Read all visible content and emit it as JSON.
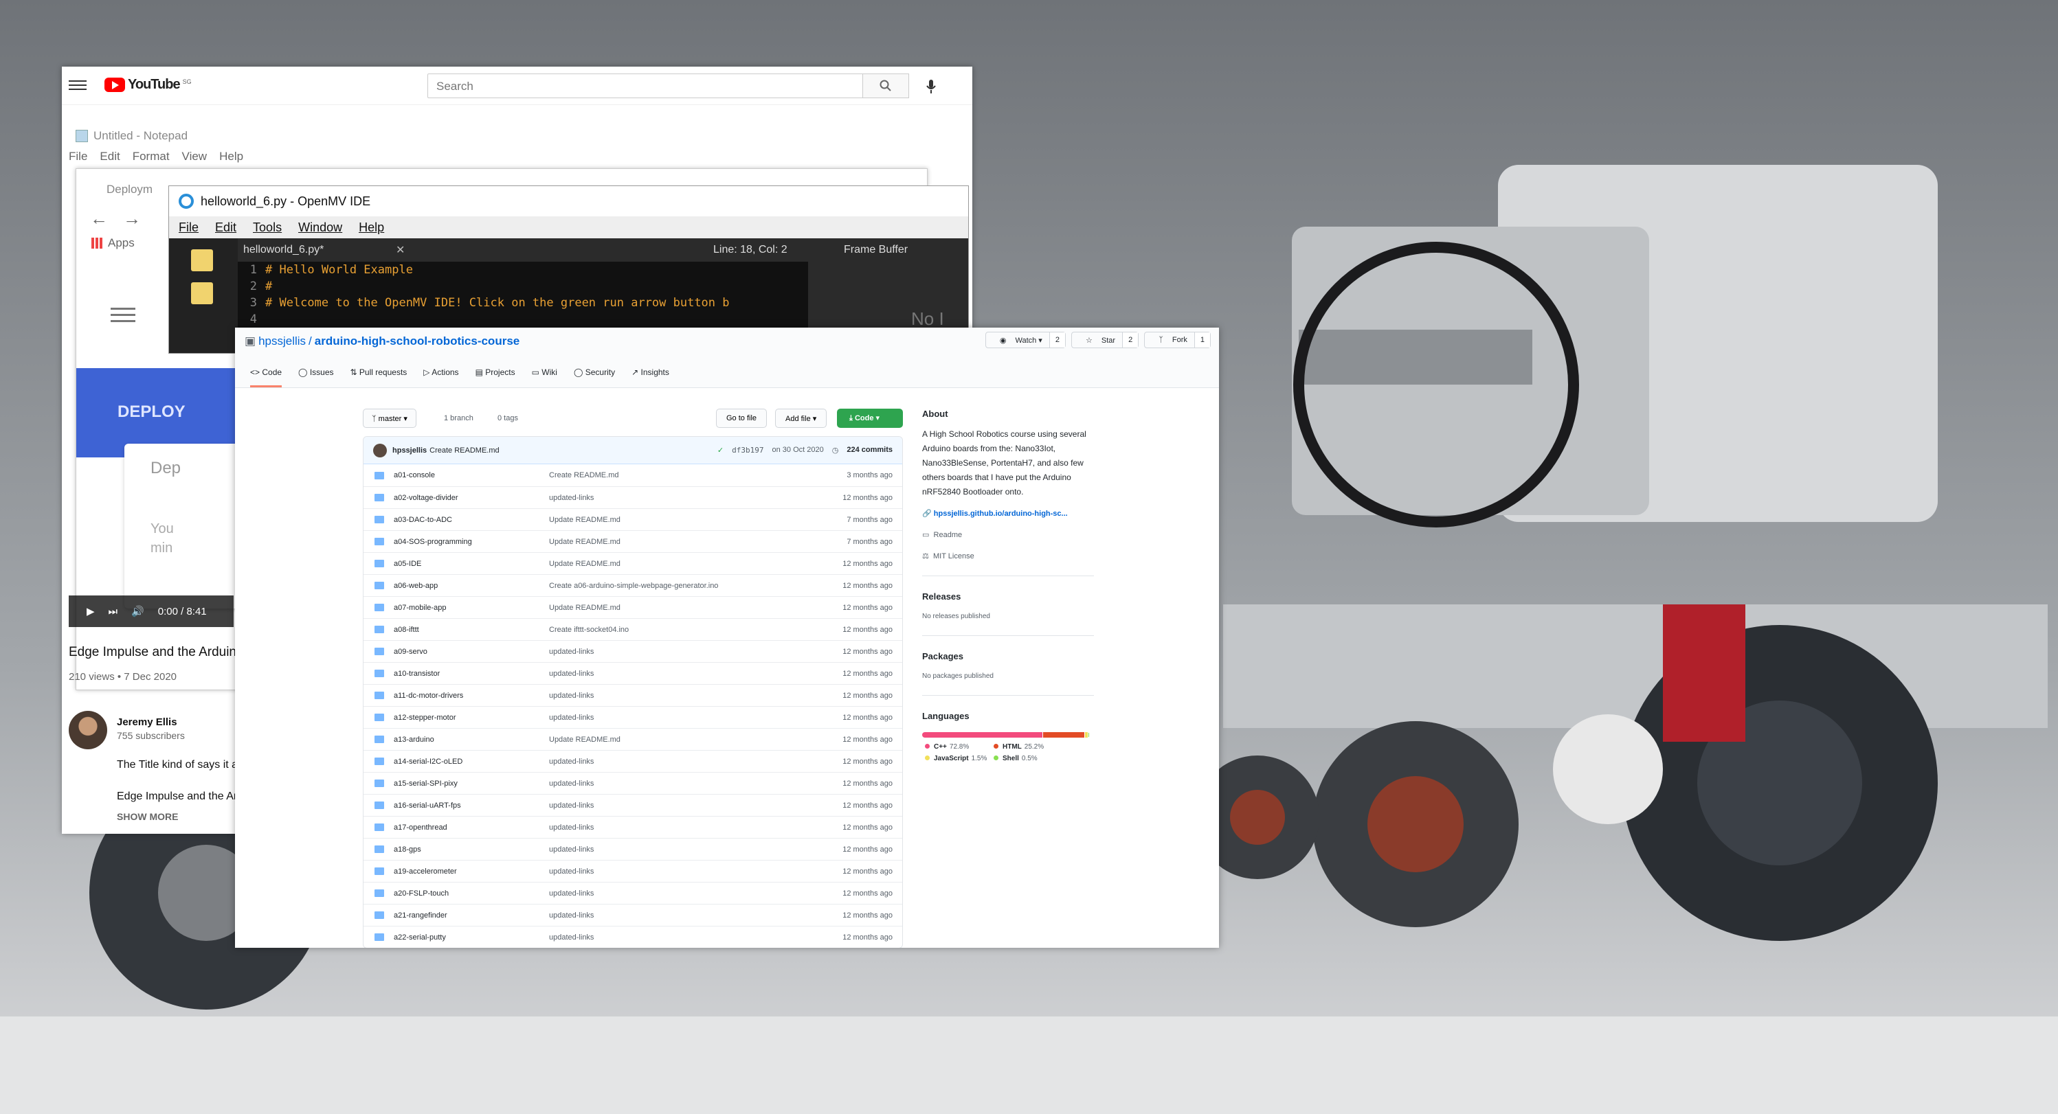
{
  "youtube": {
    "logo": "YouTube",
    "region": "SG",
    "search_placeholder": "Search",
    "video_time": "0:00 / 8:41",
    "video_title": "Edge Impulse and the Arduin",
    "video_meta": "210 views • 7 Dec 2020",
    "channel_name": "Jeremy Ellis",
    "channel_subs": "755 subscribers",
    "desc1": "The Title kind of says it al",
    "desc2": "Edge Impulse and the Ard",
    "show_more": "SHOW MORE"
  },
  "notepad": {
    "title": "Untitled - Notepad",
    "menu": [
      "File",
      "Edit",
      "Format",
      "View",
      "Help"
    ]
  },
  "chrome": {
    "tab_title": "Deploym",
    "apps_label": "Apps",
    "deploy_header": "DEPLOY",
    "card_title": "Dep",
    "card_text1": "You",
    "card_text2": "min"
  },
  "openmv": {
    "title": "helloworld_6.py - OpenMV IDE",
    "menu": [
      "File",
      "Edit",
      "Tools",
      "Window",
      "Help"
    ],
    "file_tab": "helloworld_6.py*",
    "line_col": "Line: 18, Col: 2",
    "frame_buffer": "Frame Buffer",
    "frame_text": "No I",
    "code": [
      {
        "n": "1",
        "t": "# Hello World Example"
      },
      {
        "n": "2",
        "t": "#"
      },
      {
        "n": "3",
        "t": "# Welcome to the OpenMV IDE! Click on the green run arrow button b"
      },
      {
        "n": "4",
        "t": ""
      }
    ]
  },
  "github": {
    "owner": "hpssjellis",
    "repo": "arduino-high-school-robotics-course",
    "watch": {
      "label": "Watch",
      "count": "2"
    },
    "star": {
      "label": "Star",
      "count": "2"
    },
    "fork": {
      "label": "Fork",
      "count": "1"
    },
    "tabs": [
      "Code",
      "Issues",
      "Pull requests",
      "Actions",
      "Projects",
      "Wiki",
      "Security",
      "Insights"
    ],
    "branch": "master",
    "branches": "1 branch",
    "tags": "0 tags",
    "goto_file": "Go to file",
    "add_file": "Add file",
    "code_btn": "Code",
    "commit": {
      "author": "hpssjellis",
      "message": "Create README.md",
      "sha": "df3b197",
      "date": "on 30 Oct 2020",
      "commits": "224 commits"
    },
    "files": [
      {
        "name": "a01-console",
        "msg": "Create README.md",
        "age": "3 months ago"
      },
      {
        "name": "a02-voltage-divider",
        "msg": "updated-links",
        "age": "12 months ago"
      },
      {
        "name": "a03-DAC-to-ADC",
        "msg": "Update README.md",
        "age": "7 months ago"
      },
      {
        "name": "a04-SOS-programming",
        "msg": "Update README.md",
        "age": "7 months ago"
      },
      {
        "name": "a05-IDE",
        "msg": "Update README.md",
        "age": "12 months ago"
      },
      {
        "name": "a06-web-app",
        "msg": "Create a06-arduino-simple-webpage-generator.ino",
        "age": "12 months ago"
      },
      {
        "name": "a07-mobile-app",
        "msg": "Update README.md",
        "age": "12 months ago"
      },
      {
        "name": "a08-ifttt",
        "msg": "Create ifttt-socket04.ino",
        "age": "12 months ago"
      },
      {
        "name": "a09-servo",
        "msg": "updated-links",
        "age": "12 months ago"
      },
      {
        "name": "a10-transistor",
        "msg": "updated-links",
        "age": "12 months ago"
      },
      {
        "name": "a11-dc-motor-drivers",
        "msg": "updated-links",
        "age": "12 months ago"
      },
      {
        "name": "a12-stepper-motor",
        "msg": "updated-links",
        "age": "12 months ago"
      },
      {
        "name": "a13-arduino",
        "msg": "Update README.md",
        "age": "12 months ago"
      },
      {
        "name": "a14-serial-I2C-oLED",
        "msg": "updated-links",
        "age": "12 months ago"
      },
      {
        "name": "a15-serial-SPI-pixy",
        "msg": "updated-links",
        "age": "12 months ago"
      },
      {
        "name": "a16-serial-uART-fps",
        "msg": "updated-links",
        "age": "12 months ago"
      },
      {
        "name": "a17-openthread",
        "msg": "updated-links",
        "age": "12 months ago"
      },
      {
        "name": "a18-gps",
        "msg": "updated-links",
        "age": "12 months ago"
      },
      {
        "name": "a19-accelerometer",
        "msg": "updated-links",
        "age": "12 months ago"
      },
      {
        "name": "a20-FSLP-touch",
        "msg": "updated-links",
        "age": "12 months ago"
      },
      {
        "name": "a21-rangefinder",
        "msg": "updated-links",
        "age": "12 months ago"
      },
      {
        "name": "a22-serial-putty",
        "msg": "updated-links",
        "age": "12 months ago"
      }
    ],
    "about": {
      "heading": "About",
      "text": "A High School Robotics course using several Arduino boards from the: Nano33Iot, Nano33BleSense, PortentaH7, and also few others boards that I have put the Arduino nRF52840 Bootloader onto.",
      "link": "hpssjellis.github.io/arduino-high-sc...",
      "readme": "Readme",
      "license": "MIT License"
    },
    "releases": {
      "heading": "Releases",
      "text": "No releases published"
    },
    "packages": {
      "heading": "Packages",
      "text": "No packages published"
    },
    "languages": {
      "heading": "Languages",
      "items": [
        {
          "name": "C++",
          "pct": "72.8%",
          "value": 72.8,
          "color": "#f34b7d"
        },
        {
          "name": "HTML",
          "pct": "25.2%",
          "value": 25.2,
          "color": "#e34c26"
        },
        {
          "name": "JavaScript",
          "pct": "1.5%",
          "value": 1.5,
          "color": "#f1e05a"
        },
        {
          "name": "Shell",
          "pct": "0.5%",
          "value": 0.5,
          "color": "#89e051"
        }
      ]
    }
  }
}
